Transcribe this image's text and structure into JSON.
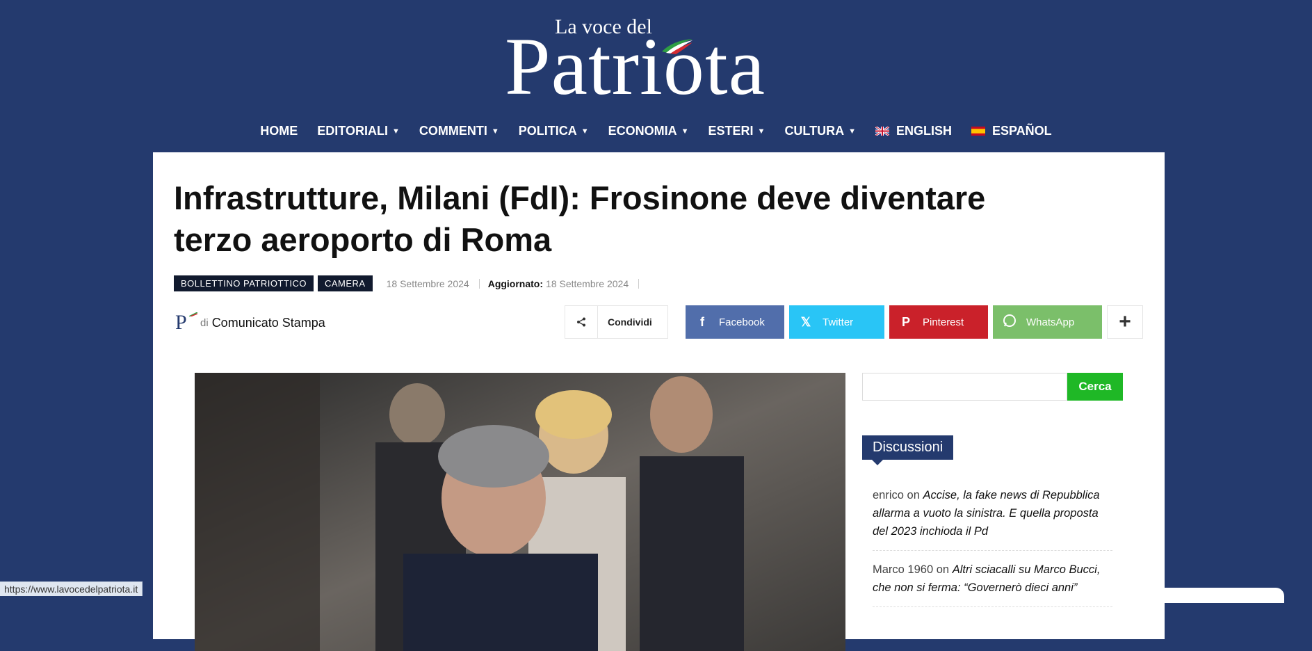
{
  "logo": {
    "small": "La voce del",
    "big": "Patriota"
  },
  "nav": {
    "items": [
      {
        "label": "HOME",
        "dropdown": false
      },
      {
        "label": "EDITORIALI",
        "dropdown": true
      },
      {
        "label": "COMMENTI",
        "dropdown": true
      },
      {
        "label": "POLITICA",
        "dropdown": true
      },
      {
        "label": "ECONOMIA",
        "dropdown": true
      },
      {
        "label": "ESTERI",
        "dropdown": true
      },
      {
        "label": "CULTURA",
        "dropdown": true
      },
      {
        "label": "ENGLISH",
        "dropdown": false,
        "flag": "uk-flag-icon"
      },
      {
        "label": "ESPAÑOL",
        "dropdown": false,
        "flag": "spain-flag-icon"
      }
    ]
  },
  "article": {
    "title": "Infrastrutture, Milani (FdI): Frosinone deve diventare terzo aeroporto di Roma",
    "tags": [
      "BOLLETTINO PATRIOTTICO",
      "CAMERA"
    ],
    "date": "18 Settembre 2024",
    "updated_label": "Aggiornato:",
    "updated_date": "18 Settembre 2024",
    "author_prefix": "di",
    "author": "Comunicato Stampa"
  },
  "share": {
    "condividi": "Condividi",
    "facebook": "Facebook",
    "twitter": "Twitter",
    "pinterest": "Pinterest",
    "whatsapp": "WhatsApp",
    "more": "+"
  },
  "sidebar": {
    "search_button": "Cerca",
    "discussions_title": "Discussioni",
    "discussions": [
      {
        "who": "enrico",
        "on": "on",
        "post": "Accise, la fake news di Repubblica allarma a vuoto la sinistra. E quella proposta del 2023 inchioda il Pd"
      },
      {
        "who": "Marco 1960",
        "on": "on",
        "post": "Altri sciacalli su Marco Bucci, che non si ferma: “Governerò dieci anni”"
      }
    ]
  },
  "statusbar": {
    "url": "https://www.lavocedelpatriota.it"
  },
  "colors": {
    "brand": "#243a6e",
    "facebook": "#516eab",
    "twitter": "#29c5f6",
    "pinterest": "#ca212a",
    "whatsapp": "#7bbf6a",
    "search": "#1fb826"
  }
}
